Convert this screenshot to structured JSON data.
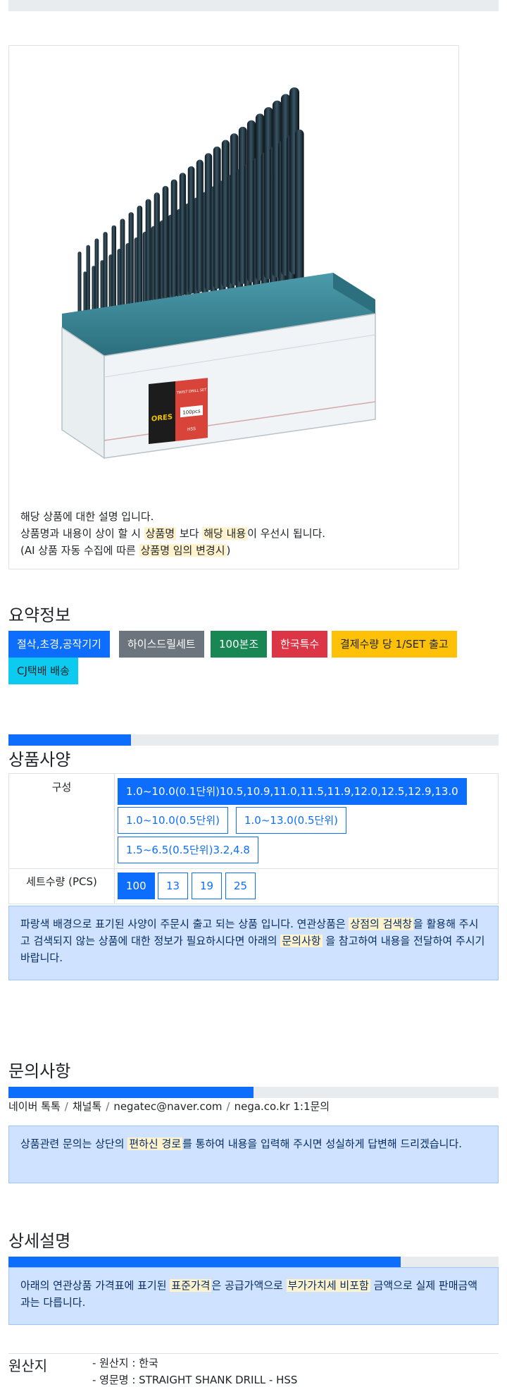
{
  "notice": {
    "line1": "해당 상품에 대한 설명 입니다.",
    "line2_a": "상품명과 내용이 상이 할 시 ",
    "line2_hl1": "상품명",
    "line2_b": " 보다 ",
    "line2_hl2": "해당 내용",
    "line2_c": "이 우선시 됩니다.",
    "line3_a": "(AI 상품 자동 수집에 따른 ",
    "line3_hl": "상품명 임의 변경시",
    "line3_b": ")"
  },
  "product_image": {
    "label_brand": "ORES",
    "label_title": "TWIST DRILL SET",
    "label_count": "100pcs",
    "label_material": "HSS"
  },
  "summary": {
    "title": "요약정보",
    "badges": [
      {
        "label": "절삭,초경,공작기기",
        "color": "#0d6efd",
        "text_color": "#ffffff"
      },
      {
        "label": "하이스드릴세트",
        "color": "#6c757d",
        "text_color": "#ffffff"
      },
      {
        "label": "100본조",
        "color": "#198754",
        "text_color": "#ffffff"
      },
      {
        "label": "한국특수",
        "color": "#dc3545",
        "text_color": "#ffffff"
      },
      {
        "label": "결제수량 당 1/SET 출고",
        "color": "#ffc107",
        "text_color": "#212529"
      },
      {
        "label": "CJ택배 배송",
        "color": "#0dcaf0",
        "text_color": "#212529"
      }
    ]
  },
  "spec": {
    "title": "상품사양",
    "progress": 0.25,
    "rows": [
      {
        "label": "구성",
        "options": [
          {
            "label": "1.0~10.0(0.1단위)10.5,10.9,11.0,11.5,11.9,12.0,12.5,12.9,13.0",
            "active": true
          },
          {
            "label": "1.0~10.0(0.5단위)",
            "active": false
          },
          {
            "label": "1.0~13.0(0.5단위)",
            "active": false
          },
          {
            "label": "1.5~6.5(0.5단위)3.2,4.8",
            "active": false
          }
        ]
      },
      {
        "label": "세트수량 (PCS)",
        "options": [
          {
            "label": "100",
            "active": true
          },
          {
            "label": "13",
            "active": false
          },
          {
            "label": "19",
            "active": false
          },
          {
            "label": "25",
            "active": false
          }
        ]
      }
    ],
    "alert_a": "파랑색 배경으로 표기된 사양이 주문시 출고 되는 상품 입니다. 연관상품은 ",
    "alert_hl1": "상점의 검색창",
    "alert_b": "을 활용해 주시고 검색되지 않는 상품에 대한 정보가 필요하시다면 아래의 ",
    "alert_hl2": "문의사항",
    "alert_c": " 을 참고하여 내용을 전달하여 주시기 바랍니다."
  },
  "inquiry": {
    "title": "문의사항",
    "progress": 0.5,
    "breadcrumb": [
      "네이버 톡톡",
      "채널톡",
      "negatec@naver.com",
      "nega.co.kr 1:1문의"
    ],
    "alert_a": "상품관련 문의는 상단의 ",
    "alert_hl": "편하신 경로",
    "alert_b": "를 통하여 내용을 입력해 주시면 성실하게 답변해 드리겠습니다."
  },
  "detail": {
    "title": "상세설명",
    "progress": 0.8,
    "alert_a": "아래의 연관상품 가격표에 표기된 ",
    "alert_hl1": "표준가격",
    "alert_b": "은 공급가액으로 ",
    "alert_hl2": "부가가치세 비포함",
    "alert_c": " 금액으로 실제 판매금액과는 다릅니다."
  },
  "origin": {
    "title": "원산지",
    "lines": [
      "- 원산지 : 한국",
      "- 영문명 : STRAIGHT SHANK DRILL - HSS"
    ]
  }
}
